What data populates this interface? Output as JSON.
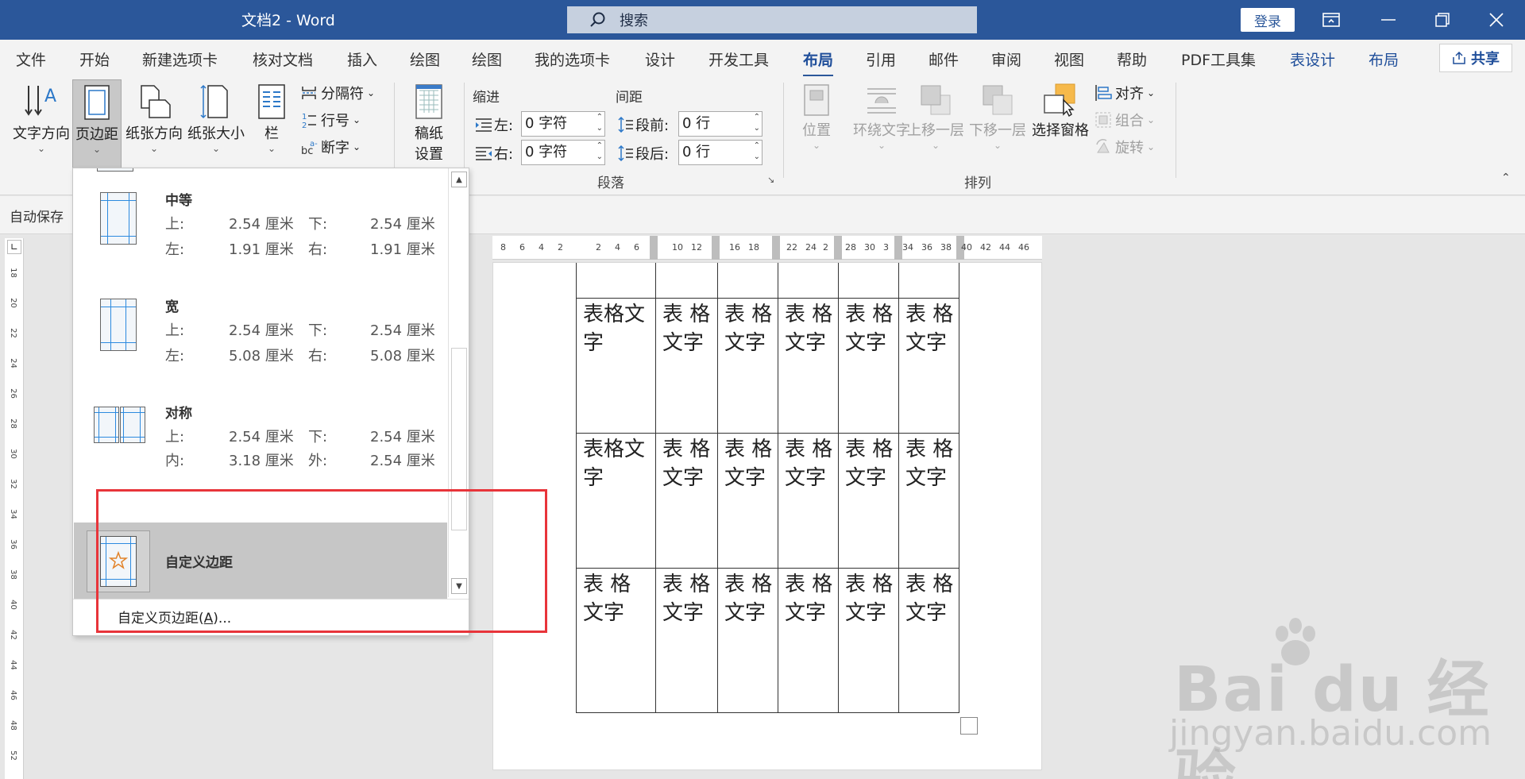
{
  "titlebar": {
    "title": "文档2  -  Word",
    "search_placeholder": "搜索",
    "login_label": "登录",
    "bg_color": "#2b579a"
  },
  "menubar": {
    "tabs": [
      {
        "label": "文件"
      },
      {
        "label": "开始"
      },
      {
        "label": "新建选项卡"
      },
      {
        "label": "核对文档"
      },
      {
        "label": "插入"
      },
      {
        "label": "绘图"
      },
      {
        "label": "绘图"
      },
      {
        "label": "我的选项卡"
      },
      {
        "label": "设计"
      },
      {
        "label": "开发工具"
      },
      {
        "label": "布局"
      },
      {
        "label": "引用"
      },
      {
        "label": "邮件"
      },
      {
        "label": "审阅"
      },
      {
        "label": "视图"
      },
      {
        "label": "帮助"
      },
      {
        "label": "PDF工具集"
      },
      {
        "label": "表设计"
      },
      {
        "label": "布局"
      }
    ],
    "active_tab": "布局",
    "share_label": "共享"
  },
  "ribbon": {
    "page_setup": {
      "text_direction": "文字方向",
      "margins": "页边距",
      "orientation": "纸张方向",
      "size": "纸张大小",
      "columns": "栏",
      "breaks": "分隔符",
      "line_numbers": "行号",
      "hyphenation": "断字"
    },
    "draft": {
      "label_line1": "稿纸",
      "label_line2": "设置"
    },
    "paragraph": {
      "indent_header": "缩进",
      "spacing_header": "间距",
      "left_label": "左:",
      "left_value": "0 字符",
      "right_label": "右:",
      "right_value": "0 字符",
      "before_label": "段前:",
      "before_value": "0 行",
      "after_label": "段后:",
      "after_value": "0 行",
      "group_label": "段落"
    },
    "arrange": {
      "position": "位置",
      "wrap_text": "环绕文字",
      "bring_forward": "上移一层",
      "send_backward": "下移一层",
      "selection_pane": "选择窗格",
      "align": "对齐",
      "group": "组合",
      "rotate": "旋转",
      "group_label": "排列"
    }
  },
  "autosave_label": "自动保存",
  "margins_dropdown": {
    "items": [
      {
        "name": "中等",
        "top_label": "上:",
        "top": "2.54 厘米",
        "bottom_label": "下:",
        "bottom": "2.54 厘米",
        "left_label": "左:",
        "left": "1.91 厘米",
        "right_label": "右:",
        "right": "1.91 厘米"
      },
      {
        "name": "宽",
        "top_label": "上:",
        "top": "2.54 厘米",
        "bottom_label": "下:",
        "bottom": "2.54 厘米",
        "left_label": "左:",
        "left": "5.08 厘米",
        "right_label": "右:",
        "right": "5.08 厘米"
      },
      {
        "name": "对称",
        "top_label": "上:",
        "top": "2.54 厘米",
        "bottom_label": "下:",
        "bottom": "2.54 厘米",
        "left_label": "内:",
        "left": "3.18 厘米",
        "right_label": "外:",
        "right": "2.54 厘米"
      }
    ],
    "custom_item": "自定义边距",
    "custom_link_prefix": "自定义页边距(",
    "custom_link_key": "A",
    "custom_link_suffix": ")..."
  },
  "ruler": {
    "h_ticks": [
      "8",
      "6",
      "4",
      "2",
      "2",
      "4",
      "6",
      "10",
      "12",
      "16",
      "18",
      "22",
      "24",
      "2",
      "28",
      "30",
      "3",
      "34",
      "36",
      "38",
      "40",
      "42",
      "44",
      "46"
    ],
    "v_ticks": [
      "18",
      "20",
      "22",
      "24",
      "26",
      "28",
      "30",
      "32",
      "34",
      "36",
      "38",
      "40",
      "42",
      "44",
      "46",
      "48",
      "52"
    ]
  },
  "document": {
    "table_rows": [
      [
        "",
        "",
        "",
        "",
        "",
        ""
      ],
      [
        "表格文字",
        "表 格文字",
        "表 格文字",
        "表 格文字",
        "表 格文字",
        "表 格文字"
      ],
      [
        "表格文字",
        "表 格文字",
        "表 格文字",
        "表 格文字",
        "表 格文字",
        "表 格文字"
      ],
      [
        "表 格文字",
        "表 格文字",
        "表 格文字",
        "表 格文字",
        "表 格文字",
        "表 格文字"
      ]
    ]
  },
  "watermark": {
    "brand": "Bai du 经验",
    "url": "jingyan.baidu.com"
  },
  "colors": {
    "accent": "#2b579a",
    "highlight": "#e8343a",
    "guide_blue": "#2c8adf",
    "star_orange": "#e2832a"
  }
}
